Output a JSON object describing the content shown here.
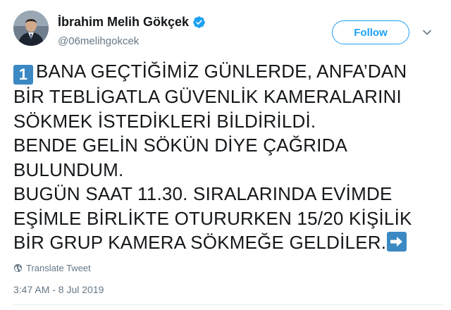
{
  "author": {
    "display_name": "İbrahim Melih Gökçek",
    "handle": "@06melihgokcek",
    "verified_icon": "verified-badge-icon",
    "avatar_icon": "profile-photo"
  },
  "actions": {
    "follow_label": "Follow",
    "menu_icon": "chevron-down-icon"
  },
  "tweet": {
    "number_emoji": "1",
    "lines": [
      "BANA GEÇTİĞİMİZ GÜNLERDE, ANFA’DAN",
      "BİR TEBLİGATLA GÜVENLİK KAMERALARINI",
      "SÖKMEK İSTEDİKLERİ BİLDİRİLDİ.",
      "BENDE GELİN SÖKÜN DİYE ÇAĞRIDA",
      "BULUNDUM.",
      "BUGÜN SAAT 11.30. SIRALARINDA EVİMDE",
      "EŞİMLE BİRLİKTE OTURURKEN 15/20 KİŞİLİK",
      "BİR GRUP KAMERA SÖKMEĞE GELDİLER."
    ],
    "trailing_emoji": "right-arrow-icon"
  },
  "translate": {
    "label": "Translate Tweet",
    "icon": "globe-icon"
  },
  "timestamp": "3:47 AM - 8 Jul 2019",
  "colors": {
    "accent": "#1da1f2",
    "secondary_text": "#657786",
    "emoji_blue": "#3b88c3"
  }
}
